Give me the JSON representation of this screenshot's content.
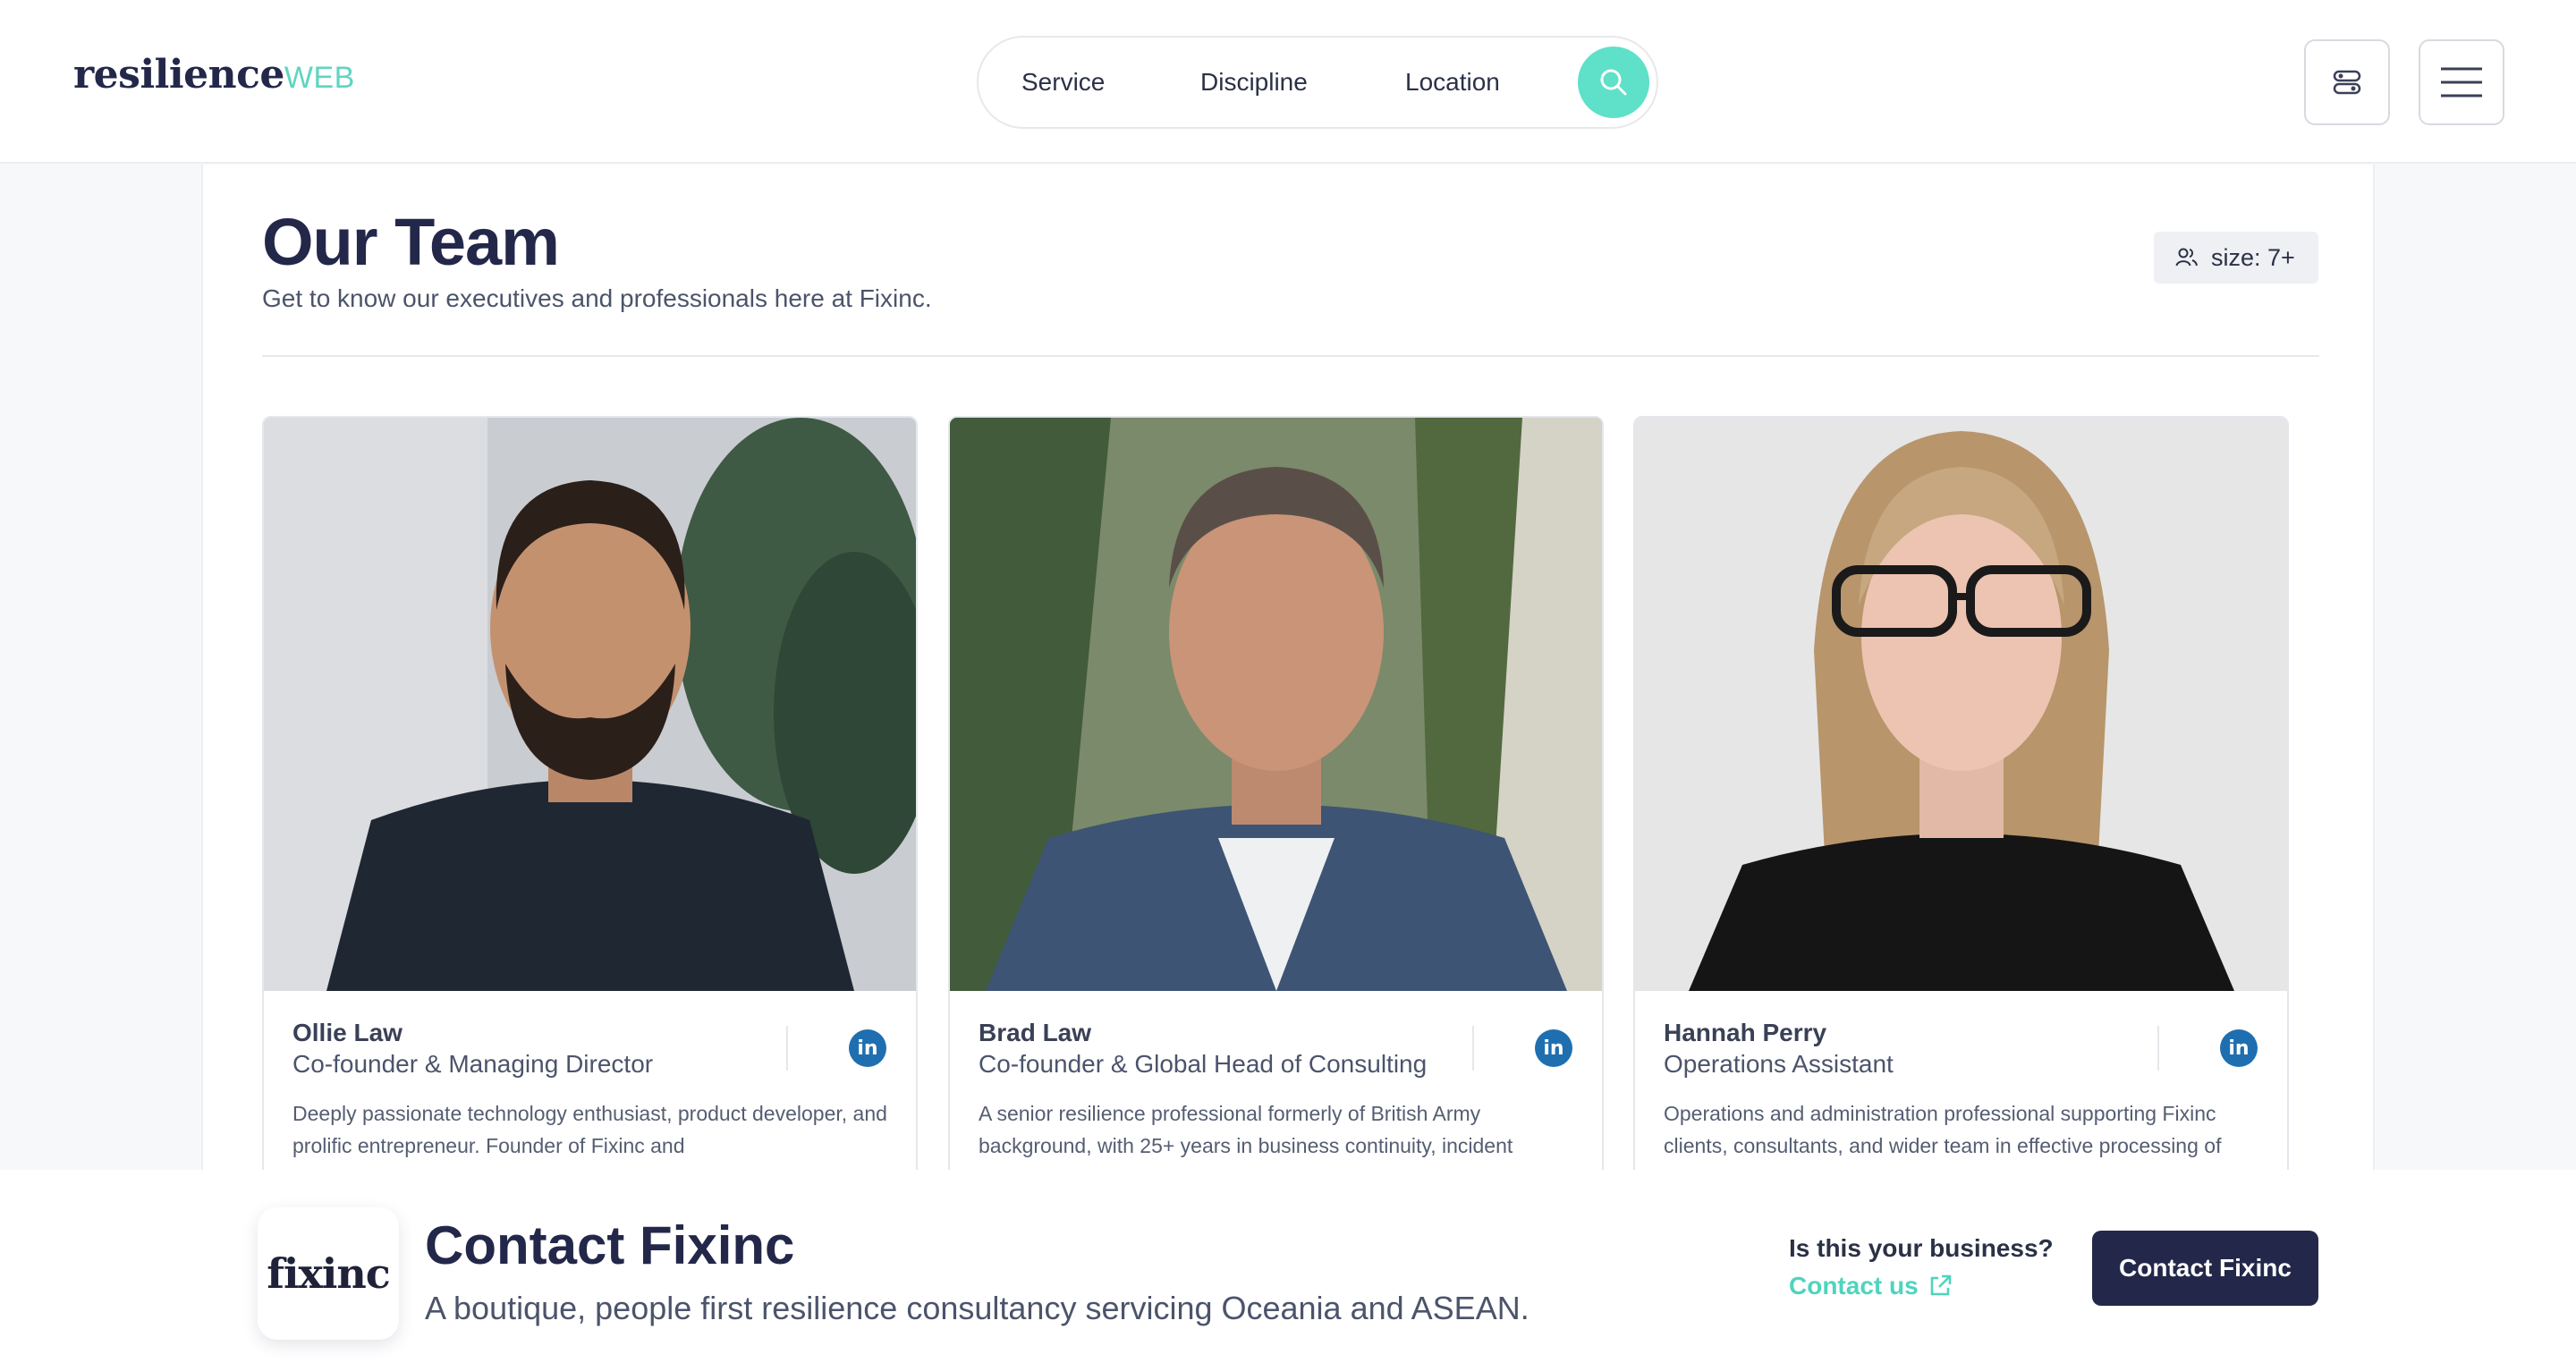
{
  "header": {
    "logo_main": "resilience",
    "logo_accent": "WEB",
    "search": {
      "service_label": "Service",
      "discipline_label": "Discipline",
      "location_label": "Location",
      "button_icon": "search-icon"
    },
    "filter_icon": "toggles-icon",
    "menu_icon": "hamburger-icon"
  },
  "main": {
    "title": "Our Team",
    "subtitle": "Get to know our executives and professionals here at Fixinc.",
    "size_badge": "size: 7+",
    "team": [
      {
        "name": "Ollie Law",
        "role": "Co-founder & Managing Director",
        "bio": "Deeply passionate technology enthusiast, product developer, and prolific entrepreneur. Founder of Fixinc and",
        "linkedin_label": "in"
      },
      {
        "name": "Brad Law",
        "role": "Co-founder & Global Head of Consulting",
        "bio": "A senior resilience professional formerly of British Army background, with 25+ years in business continuity, incident",
        "linkedin_label": "in"
      },
      {
        "name": "Hannah Perry",
        "role": "Operations Assistant",
        "bio": "Operations and administration professional supporting Fixinc clients, consultants, and wider team in effective processing of",
        "linkedin_label": "in"
      }
    ]
  },
  "contact_bar": {
    "logo_text": "fixinc",
    "title": "Contact Fixinc",
    "subtitle": "A boutique, people first resilience consultancy servicing Oceania and ASEAN.",
    "question": "Is this your business?",
    "link_label": "Contact us",
    "button_label": "Contact Fixinc"
  },
  "colors": {
    "brand_navy": "#23284a",
    "accent_teal": "#5fe0c8",
    "linkedin_blue": "#1f6fb0"
  }
}
